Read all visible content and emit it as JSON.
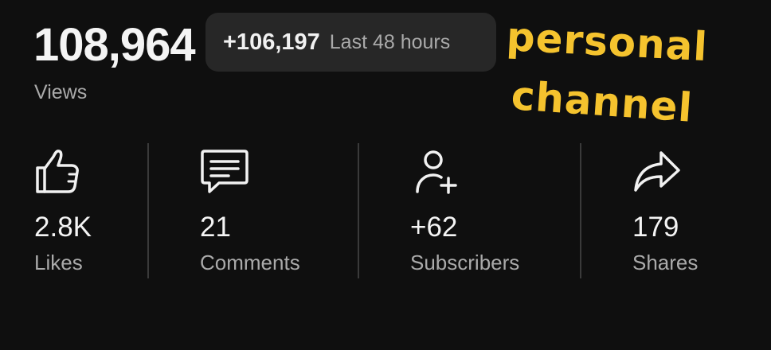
{
  "views": {
    "count": "108,964",
    "label": "Views"
  },
  "recent": {
    "delta": "+106,197",
    "period": "Last 48 hours"
  },
  "sticker": {
    "line1": "personal",
    "line2": "channel",
    "color": "#f5c32e"
  },
  "stats": [
    {
      "icon": "thumbs-up-icon",
      "value": "2.8K",
      "label": "Likes"
    },
    {
      "icon": "comment-icon",
      "value": "21",
      "label": "Comments"
    },
    {
      "icon": "add-person-icon",
      "value": "+62",
      "label": "Subscribers"
    },
    {
      "icon": "share-icon",
      "value": "179",
      "label": "Shares"
    }
  ],
  "colors": {
    "background": "#0f0f0f",
    "pill": "#272727",
    "primary_text": "#f1f1f1",
    "secondary_text": "#aaaaaa",
    "divider": "#3a3a3a"
  }
}
